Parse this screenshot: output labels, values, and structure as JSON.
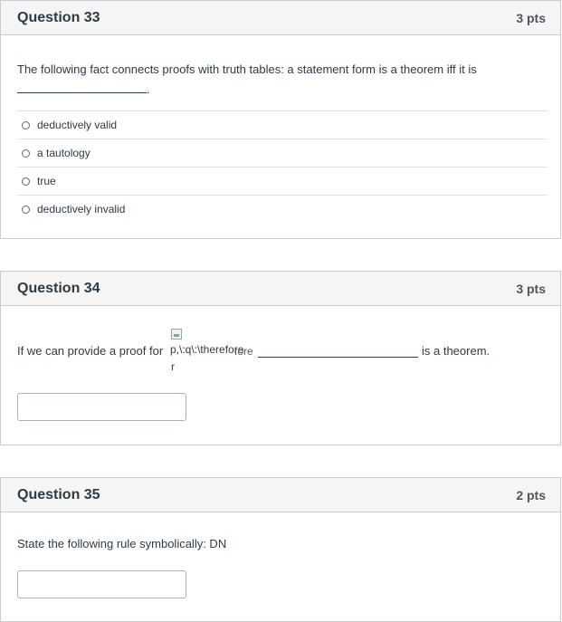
{
  "q33": {
    "title": "Question 33",
    "points": "3 pts",
    "text": "The following fact connects proofs with truth tables: a statement form is a theorem iff it is",
    "blank_suffix": ".",
    "answers": [
      {
        "label": "deductively valid"
      },
      {
        "label": "a tautology"
      },
      {
        "label": "true"
      },
      {
        "label": "deductively invalid"
      }
    ]
  },
  "q34": {
    "title": "Question 34",
    "points": "3 pts",
    "text_before": "If we can provide a proof for",
    "formula_line1": "p,\\:q\\:\\therefore",
    "formula_overlap": "fore",
    "formula_line2": "r",
    "text_after": "is a theorem.",
    "answer_value": ""
  },
  "q35": {
    "title": "Question 35",
    "points": "2 pts",
    "text": "State the following rule symbolically: DN",
    "answer_value": ""
  }
}
